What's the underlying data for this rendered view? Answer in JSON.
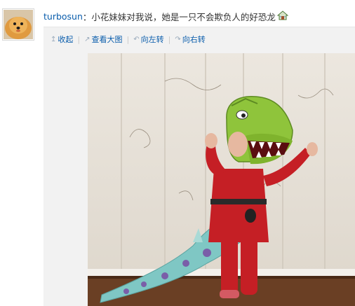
{
  "post": {
    "username": "turbosun",
    "separator": "：",
    "text": "小花妹妹对我说，她是一只不会欺负人的好恐龙",
    "emoji": "house-emoji"
  },
  "toolbar": {
    "collapse_label": "收起",
    "view_large_label": "查看大图",
    "rotate_left_label": "向左转",
    "rotate_right_label": "向右转"
  },
  "icons": {
    "collapse": "up-arrow-icon",
    "view_large": "external-link-icon",
    "rotate_left": "rotate-left-icon",
    "rotate_right": "rotate-right-icon"
  },
  "colors": {
    "link": "#0a5dac",
    "panel_bg": "#f2f2f2",
    "wall": "#e9e4dc",
    "floor": "#6a3f24",
    "costume_red": "#c51f25",
    "dino_green": "#8fc43b",
    "tail_teal": "#7fc7c4"
  }
}
